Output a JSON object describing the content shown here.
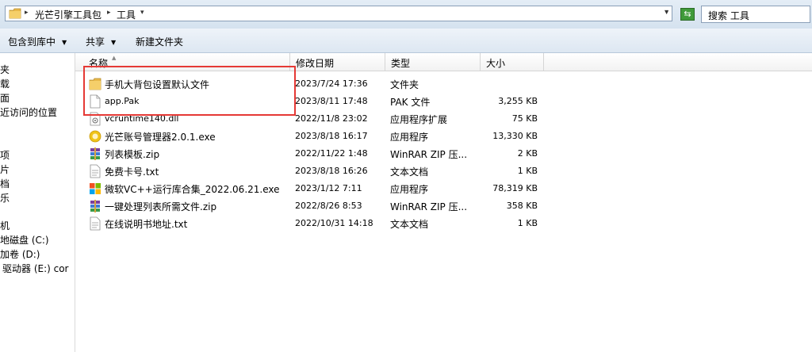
{
  "address_bar": {
    "crumbs": [
      "光芒引擎工具包",
      "工具"
    ],
    "search_placeholder": "搜索 工具"
  },
  "toolbar": {
    "include_library": "包含到库中",
    "share": "共享",
    "new_folder": "新建文件夹"
  },
  "nav_pane": {
    "items": [
      "夹",
      "载",
      "面",
      "近访问的位置",
      "项",
      "片",
      "档",
      "乐",
      "机",
      "地磁盘 (C:)",
      "加卷 (D:)",
      "驱动器 (E:) cor"
    ]
  },
  "columns": {
    "name": "名称",
    "date": "修改日期",
    "type": "类型",
    "size": "大小"
  },
  "files": [
    {
      "name": "手机大背包设置默认文件",
      "date": "2023/7/24 17:36",
      "type": "文件夹",
      "size": "",
      "icon": "folder-icon"
    },
    {
      "name": "app.Pak",
      "date": "2023/8/11 17:48",
      "type": "PAK 文件",
      "size": "3,255 KB",
      "icon": "file-icon"
    },
    {
      "name": "vcruntime140.dll",
      "date": "2022/11/8 23:02",
      "type": "应用程序扩展",
      "size": "75 KB",
      "icon": "dll-icon"
    },
    {
      "name": "光芒账号管理器2.0.1.exe",
      "date": "2023/8/18 16:17",
      "type": "应用程序",
      "size": "13,330 KB",
      "icon": "app-icon"
    },
    {
      "name": "列表模板.zip",
      "date": "2022/11/22 1:48",
      "type": "WinRAR ZIP 压...",
      "size": "2 KB",
      "icon": "winrar-icon"
    },
    {
      "name": "免费卡号.txt",
      "date": "2023/8/18 16:26",
      "type": "文本文档",
      "size": "1 KB",
      "icon": "text-file-icon"
    },
    {
      "name": "微软VC++运行库合集_2022.06.21.exe",
      "date": "2023/1/12 7:11",
      "type": "应用程序",
      "size": "78,319 KB",
      "icon": "windows-logo-icon"
    },
    {
      "name": "一键处理列表所需文件.zip",
      "date": "2022/8/26 8:53",
      "type": "WinRAR ZIP 压...",
      "size": "358 KB",
      "icon": "winrar-icon"
    },
    {
      "name": "在线说明书地址.txt",
      "date": "2022/10/31 14:18",
      "type": "文本文档",
      "size": "1 KB",
      "icon": "text-file-icon"
    }
  ],
  "colors": {
    "highlight": "#e53935",
    "folder": "#e8b84a",
    "header_bg": "#dbe6f2"
  }
}
